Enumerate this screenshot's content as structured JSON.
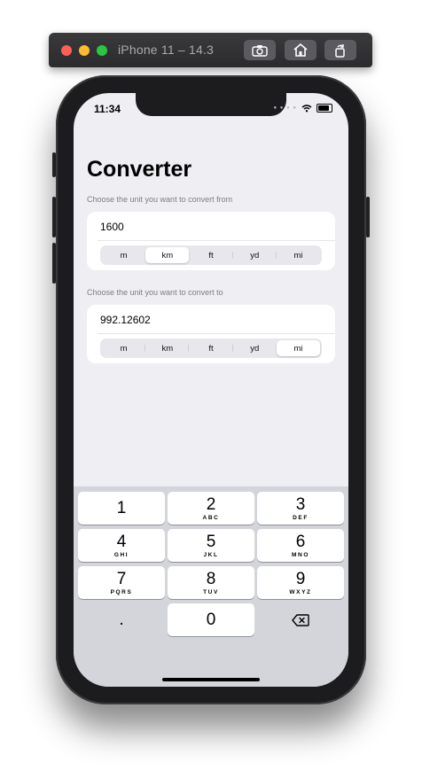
{
  "window": {
    "title": "iPhone 11 – 14.3",
    "buttons": [
      "screenshot",
      "home",
      "rotate"
    ]
  },
  "status_bar": {
    "time": "11:34"
  },
  "app": {
    "title": "Converter",
    "from": {
      "label": "Choose the unit you want to convert from",
      "value": "1600",
      "units": [
        "m",
        "km",
        "ft",
        "yd",
        "mi"
      ],
      "selected": "km"
    },
    "to": {
      "label": "Choose the unit you want to convert to",
      "value": "992.12602",
      "units": [
        "m",
        "km",
        "ft",
        "yd",
        "mi"
      ],
      "selected": "mi"
    }
  },
  "keyboard": {
    "keys": [
      {
        "num": "1",
        "letters": ""
      },
      {
        "num": "2",
        "letters": "ABC"
      },
      {
        "num": "3",
        "letters": "DEF"
      },
      {
        "num": "4",
        "letters": "GHI"
      },
      {
        "num": "5",
        "letters": "JKL"
      },
      {
        "num": "6",
        "letters": "MNO"
      },
      {
        "num": "7",
        "letters": "PQRS"
      },
      {
        "num": "8",
        "letters": "TUV"
      },
      {
        "num": "9",
        "letters": "WXYZ"
      }
    ],
    "decimal": ".",
    "zero": "0",
    "delete_icon": "delete-backward-icon"
  }
}
